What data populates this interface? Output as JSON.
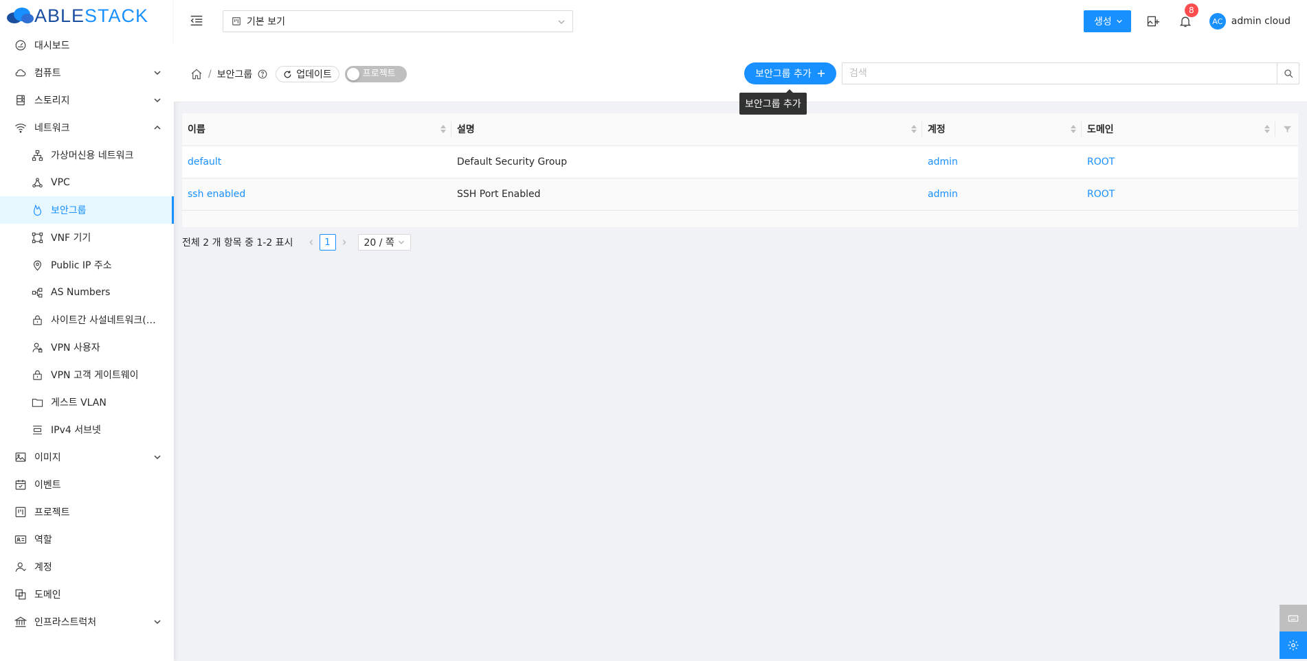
{
  "app": {
    "logo_part1": "ABLE",
    "logo_part2": "STACK"
  },
  "header": {
    "project_select_value": "기본 보기",
    "create_label": "생성",
    "notification_count": "8",
    "user_initials": "AC",
    "user_name": "admin cloud"
  },
  "sidebar": {
    "items": [
      {
        "label": "대시보드",
        "icon": "dashboard-icon"
      },
      {
        "label": "컴퓨트",
        "icon": "cloud-icon"
      },
      {
        "label": "스토리지",
        "icon": "storage-icon"
      },
      {
        "label": "네트워크",
        "icon": "wifi-icon"
      },
      {
        "label": "이미지",
        "icon": "image-icon"
      },
      {
        "label": "이벤트",
        "icon": "calendar-icon"
      },
      {
        "label": "프로젝트",
        "icon": "project-icon"
      },
      {
        "label": "역할",
        "icon": "idcard-icon"
      },
      {
        "label": "계정",
        "icon": "user-icon"
      },
      {
        "label": "도메인",
        "icon": "block-icon"
      },
      {
        "label": "인프라스트럭처",
        "icon": "bank-icon"
      }
    ],
    "network_sub": [
      {
        "label": "가상머신용 네트워크",
        "icon": "apartment-icon"
      },
      {
        "label": "VPC",
        "icon": "deployment-unit-icon"
      },
      {
        "label": "보안그룹",
        "icon": "fire-icon"
      },
      {
        "label": "VNF 기기",
        "icon": "gateway-icon"
      },
      {
        "label": "Public IP 주소",
        "icon": "environment-icon"
      },
      {
        "label": "AS Numbers",
        "icon": "partition-icon"
      },
      {
        "label": "사이트간 사설네트워크(VPN)",
        "icon": "lock-icon"
      },
      {
        "label": "VPN 사용자",
        "icon": "user-lock-icon"
      },
      {
        "label": "VPN 고객 게이트웨이",
        "icon": "lock-icon"
      },
      {
        "label": "게스트 VLAN",
        "icon": "folder-icon"
      },
      {
        "label": "IPv4 서브넷",
        "icon": "subnet-icon"
      }
    ]
  },
  "page": {
    "breadcrumb_current": "보안그룹",
    "refresh_label": "업데이트",
    "project_toggle_label": "프로젝트",
    "add_button_label": "보안그룹 추가",
    "tooltip_text": "보안그룹 추가",
    "search_placeholder": "검색"
  },
  "table": {
    "columns": [
      "이름",
      "설명",
      "계정",
      "도메인"
    ],
    "rows": [
      {
        "name": "default",
        "description": "Default Security Group",
        "account": "admin",
        "domain": "ROOT"
      },
      {
        "name": "ssh enabled",
        "description": "SSH Port Enabled",
        "account": "admin",
        "domain": "ROOT"
      }
    ]
  },
  "pagination": {
    "total_text": "전체 2 개 항목 중 1-2 표시",
    "current_page": "1",
    "page_size": "20 / 쪽"
  },
  "colors": {
    "primary": "#1890ff",
    "notification": "#ff4d4f"
  }
}
